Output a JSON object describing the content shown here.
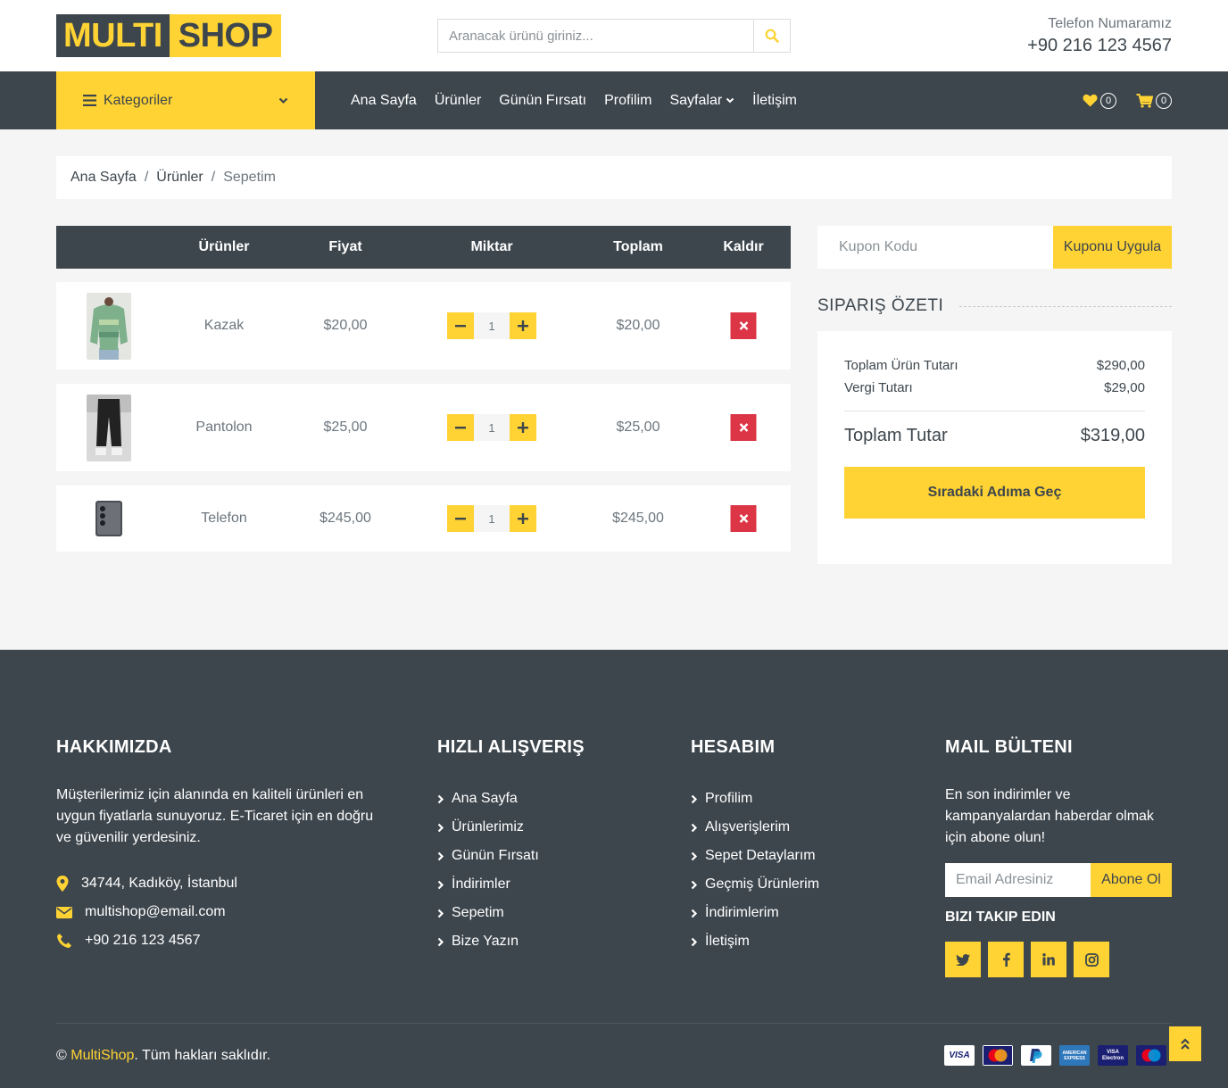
{
  "header": {
    "logo_part1": "MULTI",
    "logo_part2": "SHOP",
    "search_placeholder": "Aranacak ürünü giriniz...",
    "phone_label": "Telefon Numaramız",
    "phone_number": "+90 216 123 4567"
  },
  "nav": {
    "categories_label": "Kategoriler",
    "links": [
      "Ana Sayfa",
      "Ürünler",
      "Günün Fırsatı",
      "Profilim",
      "Sayfalar",
      "İletişim"
    ],
    "wishlist_count": "0",
    "cart_count": "0"
  },
  "breadcrumb": [
    "Ana Sayfa",
    "Ürünler",
    "Sepetim"
  ],
  "cart": {
    "headers": [
      "Ürünler",
      "Fiyat",
      "Miktar",
      "Toplam",
      "Kaldır"
    ],
    "rows": [
      {
        "name": "Kazak",
        "price": "$20,00",
        "qty": "1",
        "total": "$20,00"
      },
      {
        "name": "Pantolon",
        "price": "$25,00",
        "qty": "1",
        "total": "$25,00"
      },
      {
        "name": "Telefon",
        "price": "$245,00",
        "qty": "1",
        "total": "$245,00"
      }
    ]
  },
  "coupon": {
    "placeholder": "Kupon Kodu",
    "button": "Kuponu Uygula"
  },
  "summary": {
    "title": "SIPARIŞ ÖZETI",
    "subtotal_label": "Toplam Ürün Tutarı",
    "subtotal_value": "$290,00",
    "tax_label": "Vergi Tutarı",
    "tax_value": "$29,00",
    "total_label": "Toplam Tutar",
    "total_value": "$319,00",
    "checkout_button": "Sıradaki Adıma Geç"
  },
  "footer": {
    "about_title": "HAKKIMIZDA",
    "about_text": "Müşterilerimiz için alanında en kaliteli ürünleri en uygun fiyatlarla sunuyoruz. E-Ticaret için en doğru ve güvenilir yerdesiniz.",
    "address": "34744, Kadıköy, İstanbul",
    "email": "multishop@email.com",
    "phone": "+90 216 123 4567",
    "quick_title": "HIZLI ALIŞVERIŞ",
    "quick_links": [
      "Ana Sayfa",
      "Ürünlerimiz",
      "Günün Fırsatı",
      "İndirimler",
      "Sepetim",
      "Bize Yazın"
    ],
    "account_title": "HESABIM",
    "account_links": [
      "Profilim",
      "Alışverişlerim",
      "Sepet Detaylarım",
      "Geçmiş Ürünlerim",
      "İndirimlerim",
      "İletişim"
    ],
    "newsletter_title": "MAIL BÜLTENI",
    "newsletter_text": "En son indirimler ve kampanyalardan haberdar olmak için abone olun!",
    "newsletter_placeholder": "Email Adresiniz",
    "newsletter_button": "Abone Ol",
    "follow_title": "BIZI TAKIP EDIN",
    "copyright_symbol": "©",
    "copyright_brand": "MultiShop",
    "copyright_rest": ". Tüm hakları saklıdır.",
    "payment_cards": [
      "VISA",
      "MasterCard",
      "PayPal",
      "AMERICAN EXPRESS",
      "VISA Electron",
      "Maestro"
    ]
  },
  "colors": {
    "primary": "#ffd333",
    "dark": "#3d464d",
    "danger": "#dc3545",
    "light": "#f5f5f5"
  }
}
